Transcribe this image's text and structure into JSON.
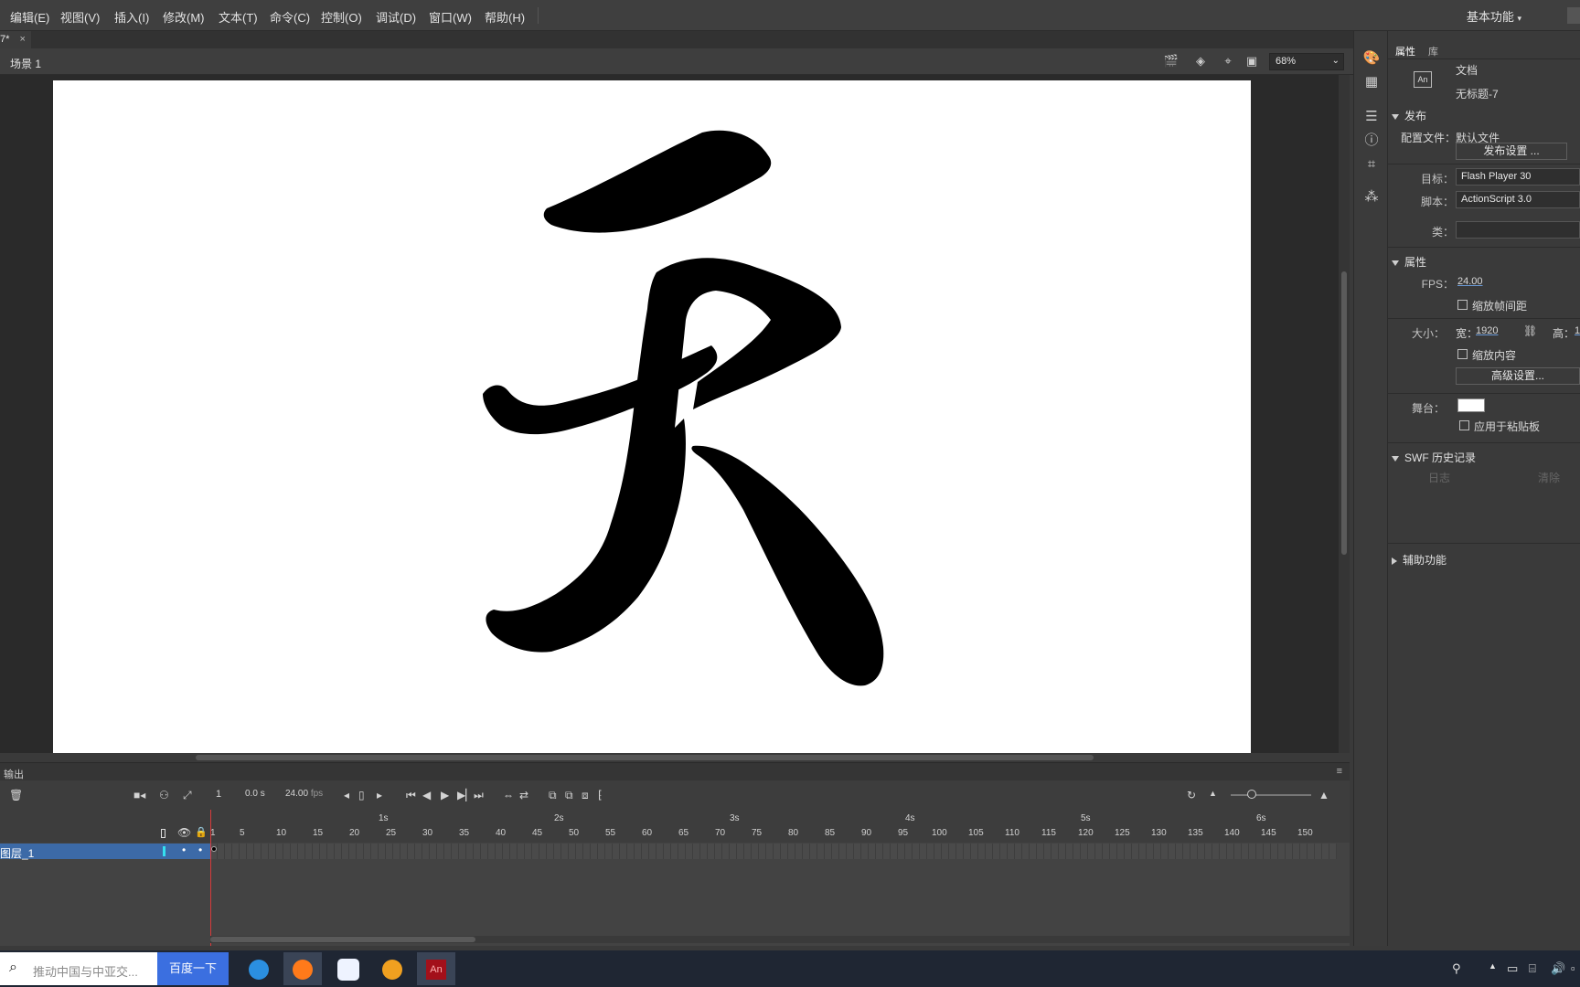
{
  "menubar": {
    "items": [
      "编辑(E)",
      "视图(V)",
      "插入(I)",
      "修改(M)",
      "文本(T)",
      "命令(C)",
      "控制(O)",
      "调试(D)",
      "窗口(W)",
      "帮助(H)"
    ],
    "workspace": "基本功能"
  },
  "document_tab": {
    "label": "7*",
    "close": "×"
  },
  "scene": {
    "label": "场景 1",
    "zoom": "68%"
  },
  "stage": {
    "character": "天",
    "background": "#ffffff"
  },
  "properties_panel": {
    "tabs": [
      "属性",
      "库"
    ],
    "doc_type": "文档",
    "doc_name": "无标题-7",
    "doc_icon": "An",
    "publish": {
      "section": "发布",
      "profile_label": "配置文件：",
      "profile_value": "默认文件",
      "settings_button": "发布设置 ...",
      "target_label": "目标：",
      "target_value": "Flash Player 30",
      "script_label": "脚本：",
      "script_value": "ActionScript 3.0",
      "class_label": "类："
    },
    "properties": {
      "section": "属性",
      "fps_label": "FPS：",
      "fps_value": "24.00",
      "scale_spans": "缩放帧间距",
      "size_label": "大小：",
      "width_label": "宽：",
      "width_value": "1920",
      "height_label": "高：",
      "height_value": "1",
      "scale_content": "缩放内容",
      "advanced_button": "高级设置...",
      "stage_label": "舞台：",
      "stage_color": "#ffffff",
      "apply_pasteboard": "应用于粘贴板"
    },
    "swf_history": {
      "section": "SWF 历史记录",
      "log_button": "日志",
      "clear_button": "清除"
    },
    "accessibility": {
      "section": "辅助功能"
    }
  },
  "output": {
    "label": "输出"
  },
  "timeline": {
    "frame": "1",
    "time": "0.0",
    "time_unit": "s",
    "fps": "24.00",
    "fps_unit": "fps",
    "seconds": [
      "1s",
      "2s",
      "3s",
      "4s",
      "5s",
      "6s"
    ],
    "frame_ticks": [
      "1",
      "5",
      "10",
      "15",
      "20",
      "25",
      "30",
      "35",
      "40",
      "45",
      "50",
      "55",
      "60",
      "65",
      "70",
      "75",
      "80",
      "85",
      "90",
      "95",
      "100",
      "105",
      "110",
      "115",
      "120",
      "125",
      "130",
      "135",
      "140",
      "145",
      "150"
    ],
    "layer_name": "图层_1"
  },
  "taskbar": {
    "search_placeholder": "推动中国与中亚交...",
    "search_button": "百度一下",
    "apps": [
      "edge-browser",
      "firefox",
      "baidu-netdisk",
      "media-player",
      "animate"
    ],
    "animate_label": "An"
  },
  "colors": {
    "accent": "#3c6aa7",
    "stage": "#ffffff",
    "playhead": "#d73b3b"
  }
}
